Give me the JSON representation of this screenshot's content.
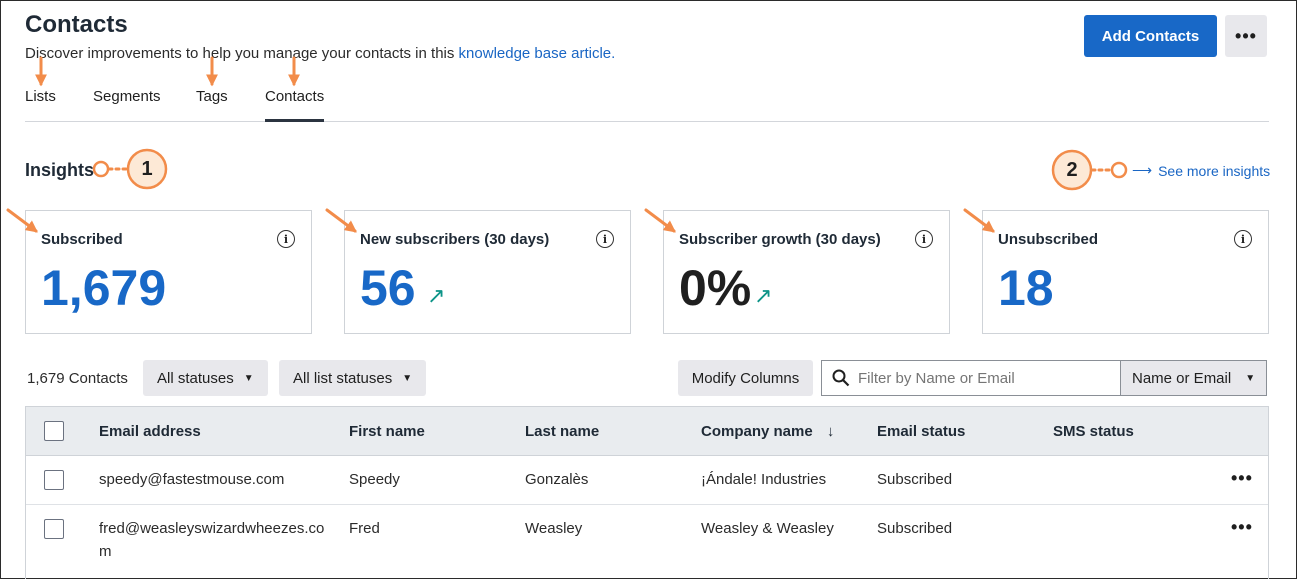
{
  "header": {
    "title": "Contacts",
    "subtitle_text": "Discover improvements to help you manage your contacts in this ",
    "subtitle_link": "knowledge base article.",
    "add_button": "Add Contacts",
    "more_button": "•••"
  },
  "tabs": [
    {
      "label": "Lists"
    },
    {
      "label": "Segments"
    },
    {
      "label": "Tags"
    },
    {
      "label": "Contacts",
      "active": true
    }
  ],
  "insights": {
    "title": "Insights",
    "see_more": "See more insights",
    "cards": [
      {
        "label": "Subscribed",
        "value": "1,679"
      },
      {
        "label": "New subscribers (30 days)",
        "value": "56",
        "trend": "up"
      },
      {
        "label": "Subscriber growth (30 days)",
        "value": "0%",
        "trend": "up"
      },
      {
        "label": "Unsubscribed",
        "value": "18"
      }
    ]
  },
  "toolbar": {
    "count": "1,679 Contacts",
    "status_filter": "All statuses",
    "list_status_filter": "All list statuses",
    "modify_columns": "Modify Columns",
    "search_placeholder": "Filter by Name or Email",
    "search_scope": "Name or Email"
  },
  "table": {
    "columns": [
      "Email address",
      "First name",
      "Last name",
      "Company name",
      "Email status",
      "SMS status"
    ],
    "sorted_column": "Company name",
    "rows": [
      {
        "email": "speedy@fastestmouse.com",
        "first": "Speedy",
        "last": "Gonzalès",
        "company": "¡Ándale! Industries",
        "email_status": "Subscribed",
        "sms_status": ""
      },
      {
        "email_line1": "fred@weasleyswizardwheezes.co",
        "email_line2": "m",
        "first": "Fred",
        "last": "Weasley",
        "company": "Weasley & Weasley",
        "email_status": "Subscribed",
        "sms_status": ""
      }
    ]
  },
  "annotations": {
    "marker_1": "1",
    "marker_2": "2",
    "color": "#f28c4a",
    "fill": "#fde9d6"
  },
  "colors": {
    "primary": "#1868c7",
    "link": "#1a66c4",
    "trend": "#0d9488"
  }
}
